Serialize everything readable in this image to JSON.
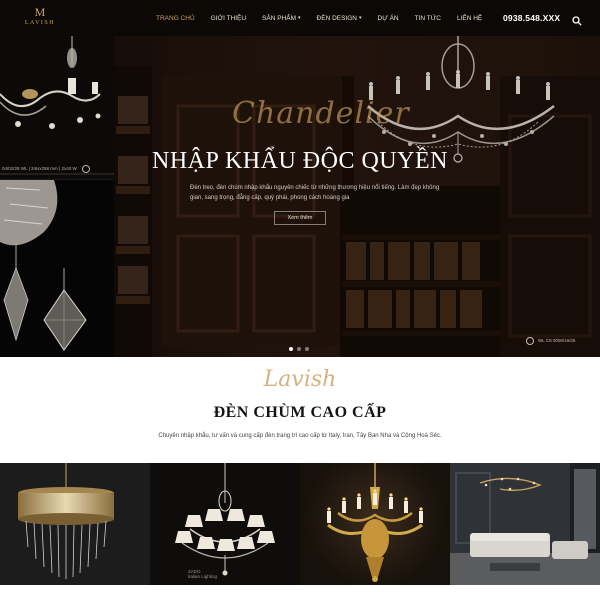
{
  "brand": {
    "mark": "M",
    "name": "LAVISH"
  },
  "nav": {
    "items": [
      {
        "label": "TRANG CHỦ",
        "active": true,
        "dropdown": false
      },
      {
        "label": "GIỚI THIỆU",
        "active": false,
        "dropdown": false
      },
      {
        "label": "SẢN PHẨM",
        "active": false,
        "dropdown": true
      },
      {
        "label": "ĐÈN DESIGN",
        "active": false,
        "dropdown": true
      },
      {
        "label": "DỰ ÁN",
        "active": false,
        "dropdown": false
      },
      {
        "label": "TIN TỨC",
        "active": false,
        "dropdown": false
      },
      {
        "label": "LIÊN HỆ",
        "active": false,
        "dropdown": false
      }
    ],
    "phone": "0938.548.XXX",
    "search_icon": "search-icon"
  },
  "left_panel": {
    "caption": "04/02/28 WL | 34Hx258 mm | 2x40 W"
  },
  "hero": {
    "script": "Chandelier",
    "title": "NHẬP KHẨU ĐỘC QUYỀN",
    "description": "Đèn treo, đèn chùm nhập khẩu nguyên chiếc từ những thương hiệu nổi tiếng. Làm đẹp không gian, sang trọng, đẳng cấp, quý phái, phong cách hoàng gia",
    "button": "Xem thêm",
    "caption": "WL C8 0008/16/25",
    "slide_count": 3,
    "active_slide": 1
  },
  "intro": {
    "script": "Lavish",
    "title": "ĐÈN CHÙM CAO CẤP",
    "description": "Chuyên nhập khẩu, tư vấn và cung cấp đèn trang trí cao cấp từ Italy, Iran, Tây Ban Nha và Cộng Hoà Séc."
  },
  "products": [
    {
      "name": "gold-drum-chandelier"
    },
    {
      "name": "crystal-shade-chandelier",
      "watermark_line1": "ZADO",
      "watermark_line2": "Italian Lighting"
    },
    {
      "name": "gold-candle-chandelier"
    },
    {
      "name": "living-room-scene"
    }
  ],
  "colors": {
    "header_bg": "#0b0805",
    "accent_gold": "#c9a25f",
    "hero_bg": "#2a1810",
    "script_gold": "#d2b382"
  }
}
